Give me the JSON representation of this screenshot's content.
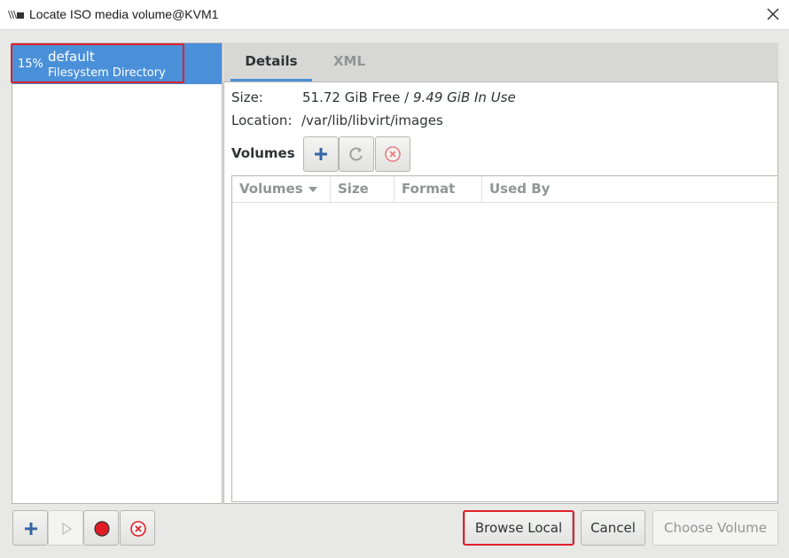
{
  "window": {
    "title": "Locate ISO media volume@KVM1",
    "app_icon": "virt-manager-icon",
    "close_icon": "close-icon"
  },
  "pools": [
    {
      "percent": "15%",
      "name": "default",
      "type": "Filesystem Directory",
      "selected": true,
      "highlighted": true
    }
  ],
  "tabs": [
    {
      "label": "Details",
      "active": true
    },
    {
      "label": "XML",
      "active": false
    }
  ],
  "details": {
    "size_label": "Size:",
    "size_free": "51.72 GiB Free",
    "size_separator": " / ",
    "size_in_use": "9.49 GiB In Use",
    "location_label": "Location:",
    "location_value": "/var/lib/libvirt/images",
    "volumes_label": "Volumes",
    "volume_toolbar": [
      {
        "icon": "add-icon",
        "enabled": true
      },
      {
        "icon": "refresh-icon",
        "enabled": false
      },
      {
        "icon": "delete-icon",
        "enabled": false
      }
    ],
    "table": {
      "columns": [
        "Volumes",
        "Size",
        "Format",
        "Used By"
      ],
      "sort_column": "Volumes",
      "rows": []
    }
  },
  "pool_toolbar": [
    {
      "icon": "add-icon",
      "enabled": true
    },
    {
      "icon": "play-icon",
      "enabled": false
    },
    {
      "icon": "stop-record-icon",
      "enabled": true
    },
    {
      "icon": "delete-icon",
      "enabled": true
    }
  ],
  "actions": {
    "browse_local": "Browse Local",
    "cancel": "Cancel",
    "choose_volume": "Choose Volume"
  },
  "colors": {
    "selection": "#4a90d9",
    "highlight_border": "#e0212b",
    "record_red": "#e01b24",
    "delete_red": "#e0212b",
    "add_blue": "#3465a4"
  }
}
